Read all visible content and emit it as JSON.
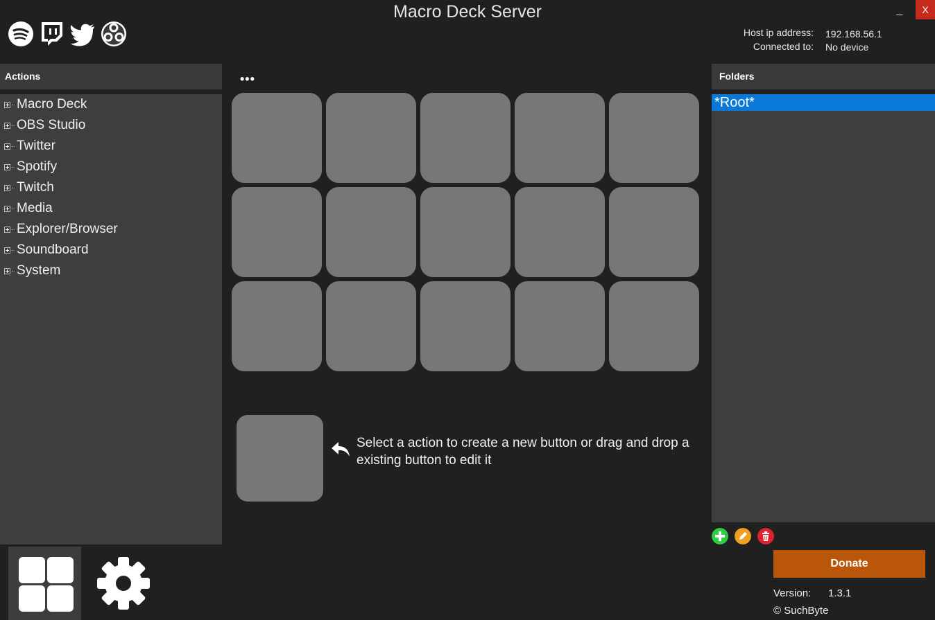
{
  "window": {
    "title": "Macro Deck Server",
    "minimize_label": "_",
    "close_label": "X"
  },
  "header": {
    "social_icons": [
      "spotify-icon",
      "twitch-icon",
      "twitter-icon",
      "obs-icon"
    ],
    "host_label": "Host ip address:",
    "host_value": "192.168.56.1",
    "connected_label": "Connected to:",
    "connected_value": "No device"
  },
  "actions": {
    "heading": "Actions",
    "items": [
      {
        "label": "Macro Deck"
      },
      {
        "label": "OBS Studio"
      },
      {
        "label": "Twitter"
      },
      {
        "label": "Spotify"
      },
      {
        "label": "Twitch"
      },
      {
        "label": "Media"
      },
      {
        "label": "Explorer/Browser"
      },
      {
        "label": "Soundboard"
      },
      {
        "label": "System"
      }
    ]
  },
  "deck": {
    "more_label": "•••",
    "rows": 3,
    "columns": 5,
    "hint": "Select a action to create a new button or drag and drop a existing button to edit it"
  },
  "folders": {
    "heading": "Folders",
    "items": [
      {
        "label": "*Root*",
        "selected": true
      }
    ]
  },
  "footer": {
    "donate_label": "Donate",
    "version_label": "Version:",
    "version_value": "1.3.1",
    "copyright": "© SuchByte"
  },
  "colors": {
    "background": "#202020",
    "panel": "#3e3e3e",
    "selection": "#0a78d7",
    "donate": "#b9560a",
    "close": "#c42b1c",
    "add": "#2ecc40",
    "edit": "#f0a020",
    "delete": "#e0202a"
  }
}
